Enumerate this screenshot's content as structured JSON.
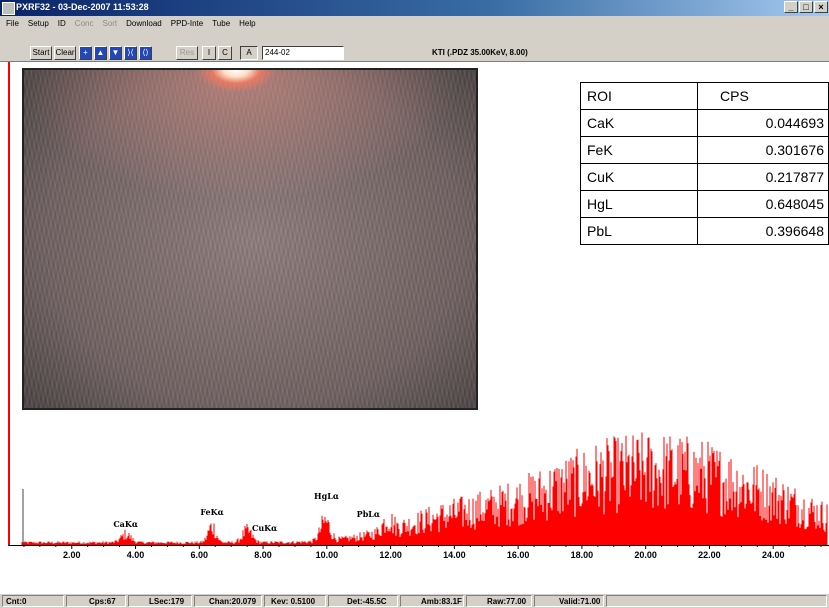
{
  "window": {
    "title": "PXRF32 - 03-Dec-2007 11:53:28",
    "minimize": "_",
    "restore": "□",
    "close": "×"
  },
  "menu": [
    "File",
    "Setup",
    "ID",
    "Conc",
    "Sort",
    "Download",
    "PPD-Inte",
    "Tube",
    "Help"
  ],
  "menu_disabled": [
    false,
    false,
    false,
    true,
    true,
    false,
    false,
    false,
    false
  ],
  "toolbar": {
    "start": "Start",
    "clear": "Clear",
    "res": "Res",
    "i": "I",
    "c": "C",
    "a": "A",
    "sample_id": "244-02",
    "kti_label": "KTI  (.PDZ 35.00KeV, 8.00)"
  },
  "roi_table": {
    "headers": [
      "ROI",
      "CPS"
    ],
    "rows": [
      [
        "CaK",
        "0.044693"
      ],
      [
        "FeK",
        "0.301676"
      ],
      [
        "CuK",
        "0.217877"
      ],
      [
        "HgL",
        "0.648045"
      ],
      [
        "PbL",
        "0.396648"
      ]
    ]
  },
  "spectrum": {
    "color": "#ff0000",
    "x_ticks": [
      "2.00",
      "4.00",
      "6.00",
      "8.00",
      "10.00",
      "12.00",
      "14.00",
      "16.00",
      "18.00",
      "20.00",
      "22.00",
      "24.00"
    ],
    "x_tick_values": [
      2,
      4,
      6,
      8,
      10,
      12,
      14,
      16,
      18,
      20,
      22,
      24
    ],
    "xlim": [
      0,
      25.75
    ],
    "peak_labels": [
      {
        "text": "CaKα",
        "kev": 3.69
      },
      {
        "text": "FeKα",
        "kev": 6.4
      },
      {
        "text": "CuKα",
        "kev": 8.05
      },
      {
        "text": "HgLα",
        "kev": 9.99
      },
      {
        "text": "PbLα",
        "kev": 10.55
      }
    ]
  },
  "status": [
    "Cnt:0",
    "Cps:67",
    "LSec:179",
    "Chan:20.079",
    "Kev: 0.5100",
    "Det:-45.5C",
    "Amb:83.1F",
    "Raw:77.00",
    "Valid:71.00"
  ]
}
